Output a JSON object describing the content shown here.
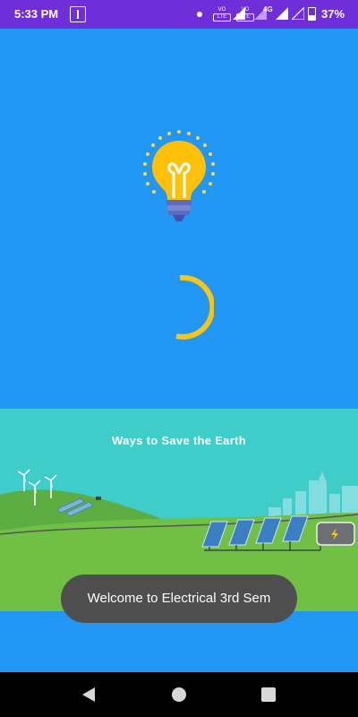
{
  "status_bar": {
    "time": "5:33 PM",
    "sim1_volte": "VO",
    "sim1_lte": "LTE",
    "sim2_volte": "VO",
    "sim2_lte": "LTE",
    "network": "4G",
    "battery": "37%",
    "battery_level": 0.37
  },
  "splash": {
    "logo_icon": "light-bulb-icon",
    "loading_icon": "spinner-icon",
    "accent_color": "#F5C518",
    "background_color": "#2196F3"
  },
  "banner": {
    "title": "Ways to Save the Earth"
  },
  "toast": {
    "message": "Welcome to Electrical 3rd Sem"
  },
  "nav_bar": {
    "back_icon": "back-triangle-icon",
    "home_icon": "home-circle-icon",
    "recents_icon": "recents-square-icon"
  }
}
